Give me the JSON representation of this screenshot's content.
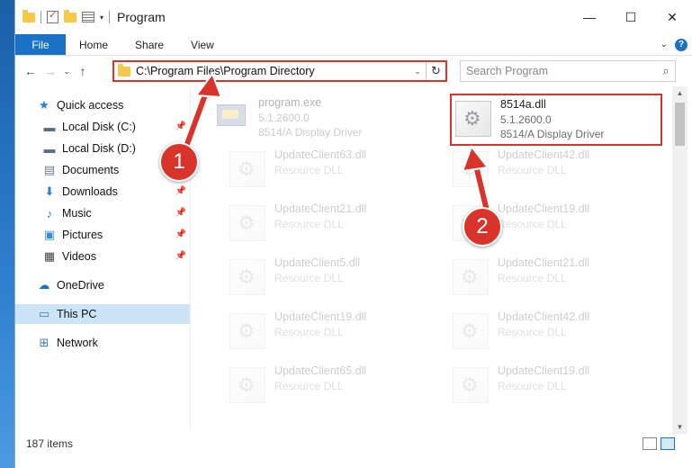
{
  "window": {
    "title": "Program",
    "controls": {
      "minimize": "—",
      "maximize": "☐",
      "close": "✕"
    }
  },
  "ribbon": {
    "tabs": [
      "File",
      "Home",
      "Share",
      "View"
    ]
  },
  "address": {
    "path": "C:\\Program Files\\Program Directory"
  },
  "search": {
    "placeholder": "Search Program"
  },
  "sidebar": {
    "items": [
      {
        "label": "Quick access",
        "icon": "star-icon",
        "pinned": false
      },
      {
        "label": "Local Disk (C:)",
        "icon": "drive-icon",
        "pinned": true
      },
      {
        "label": "Local Disk (D:)",
        "icon": "drive-icon",
        "pinned": false
      },
      {
        "label": "Documents",
        "icon": "documents-icon",
        "pinned": false
      },
      {
        "label": "Downloads",
        "icon": "download-icon",
        "pinned": true
      },
      {
        "label": "Music",
        "icon": "music-icon",
        "pinned": true
      },
      {
        "label": "Pictures",
        "icon": "pictures-icon",
        "pinned": true
      },
      {
        "label": "Videos",
        "icon": "videos-icon",
        "pinned": true
      },
      {
        "label": "OneDrive",
        "icon": "cloud-icon",
        "pinned": false
      },
      {
        "label": "This PC",
        "icon": "computer-icon",
        "pinned": false,
        "selected": true
      },
      {
        "label": "Network",
        "icon": "network-icon",
        "pinned": false
      }
    ]
  },
  "files": {
    "highlighted": {
      "name": "8514a.dll",
      "version": "5.1.2600.0",
      "description": "8514/A Display Driver"
    },
    "program_exe": {
      "name": "program.exe",
      "version": "5.1.2600.0",
      "description": "8514/A Display Driver"
    },
    "left": [
      {
        "name": "UpdateClient63.dll",
        "description": "Resource DLL"
      },
      {
        "name": "UpdateClient21.dll",
        "description": "Resource DLL"
      },
      {
        "name": "UpdateClient5.dll",
        "description": "Resource DLL"
      },
      {
        "name": "UpdateClient19.dll",
        "description": "Resource DLL"
      },
      {
        "name": "UpdateClient65.dll",
        "description": "Resource DLL"
      }
    ],
    "right": [
      {
        "name": "UpdateClient42.dll",
        "description": "Resource DLL"
      },
      {
        "name": "UpdateClient19.dll",
        "description": "Resource DLL"
      },
      {
        "name": "UpdateClient21.dll",
        "description": "Resource DLL"
      },
      {
        "name": "UpdateClient42.dll",
        "description": "Resource DLL"
      },
      {
        "name": "UpdateClient19.dll",
        "description": "Resource DLL"
      }
    ]
  },
  "status": {
    "item_count": "187 items"
  },
  "annotations": {
    "callout_1": "1",
    "callout_2": "2",
    "color": "#d9342b"
  }
}
